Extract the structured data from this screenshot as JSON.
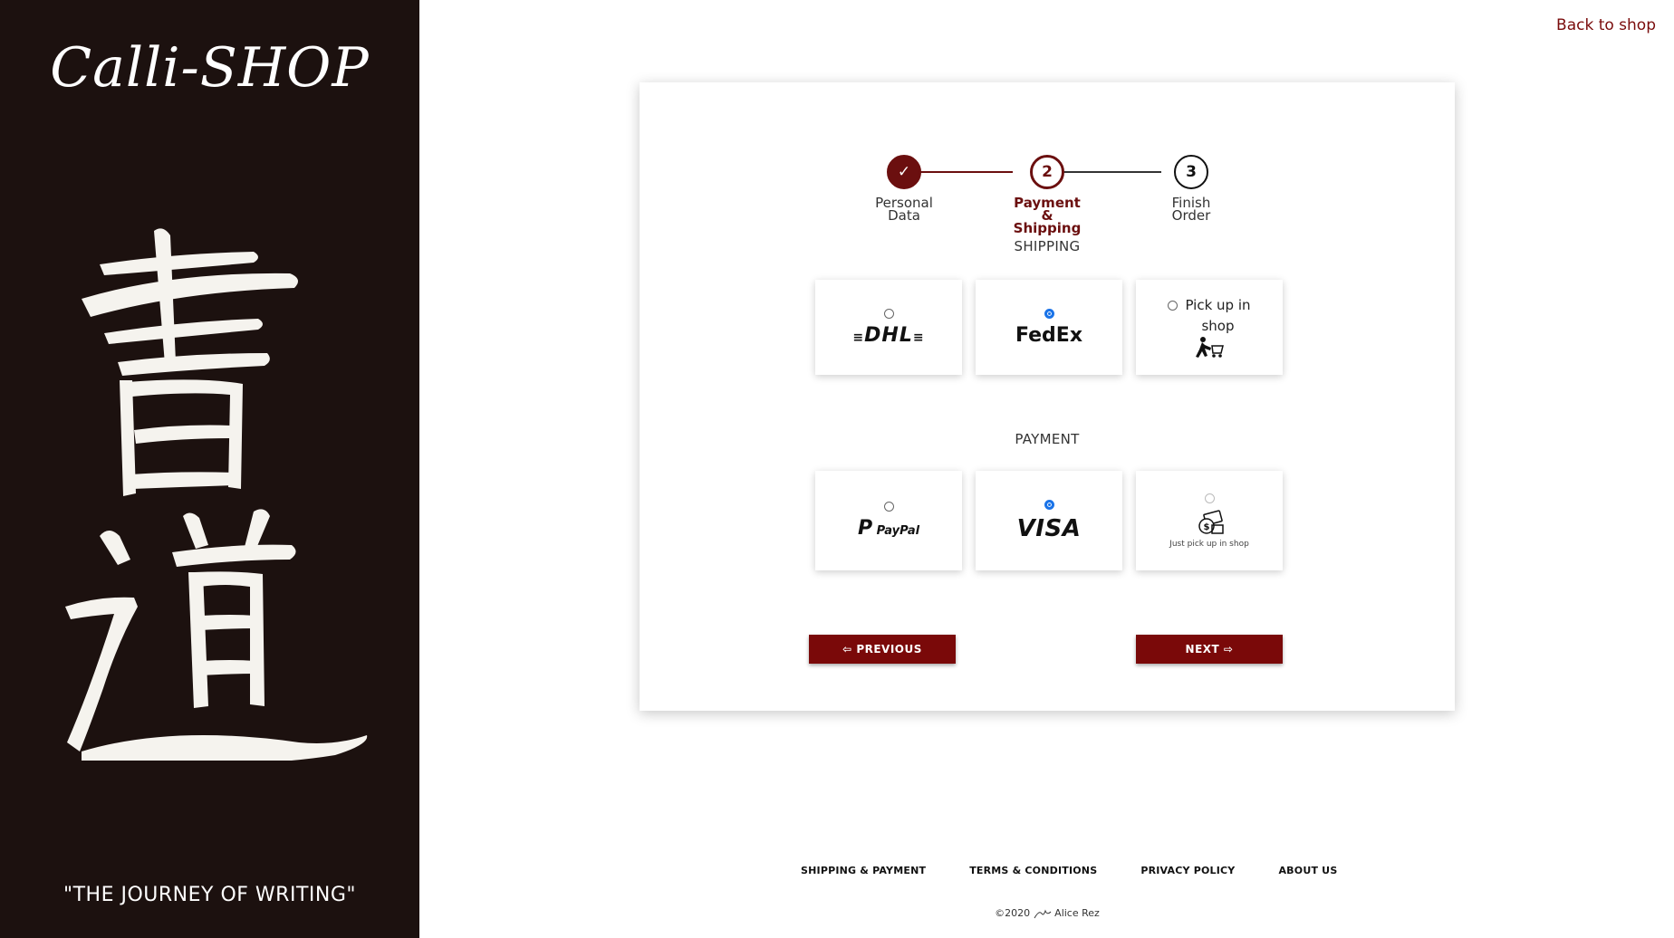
{
  "sidebar": {
    "brand": "Calli-SHOP",
    "tagline": "\"THE JOURNEY OF WRITING\""
  },
  "header": {
    "back_link": "Back to shop"
  },
  "stepper": {
    "steps": [
      {
        "number": "✓",
        "label": "Personal\nData",
        "state": "done"
      },
      {
        "number": "2",
        "label": "Payment\n&\nShipping",
        "state": "active"
      },
      {
        "number": "3",
        "label": "Finish\nOrder",
        "state": "todo"
      }
    ]
  },
  "shipping": {
    "title": "SHIPPING",
    "options": [
      {
        "name": "DHL",
        "logo": "DHL",
        "selected": false
      },
      {
        "name": "FedEx",
        "logo": "FedEx",
        "selected": true
      },
      {
        "name": "Pick up in shop",
        "label": "Pick up in\nshop",
        "icon": "shop-cart-icon",
        "selected": false
      }
    ]
  },
  "payment": {
    "title": "PAYMENT",
    "options": [
      {
        "name": "PayPal",
        "logo": "PayPal",
        "selected": false
      },
      {
        "name": "VISA",
        "logo": "VISA",
        "selected": true
      },
      {
        "name": "Cash",
        "label": "Just pick up in shop",
        "icon": "cash-icon",
        "selected": false
      }
    ]
  },
  "buttons": {
    "previous": "⇦ PREVIOUS",
    "next": "NEXT ⇨"
  },
  "footer": {
    "links": [
      "SHIPPING & PAYMENT",
      "TERMS & CONDITIONS",
      "PRIVACY POLICY",
      "ABOUT US"
    ],
    "copyright": "©2020",
    "author": "Alice Rez"
  },
  "colors": {
    "accent": "#7a0909",
    "sidebar_bg": "#1c110f",
    "radio_checked": "#1a73e8"
  }
}
